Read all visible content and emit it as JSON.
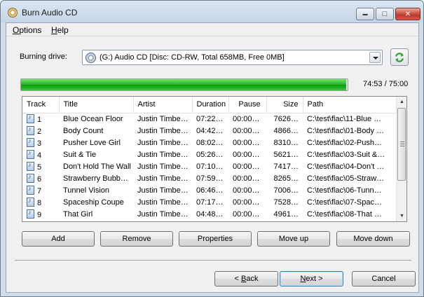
{
  "window": {
    "title": "Burn Audio CD",
    "controls": {
      "minimize": "▬",
      "maximize": "□",
      "close": "✕"
    }
  },
  "menu": [
    {
      "label": "Options",
      "accel": "O",
      "rest": "ptions"
    },
    {
      "label": "Help",
      "accel": "H",
      "rest": "elp"
    }
  ],
  "drive": {
    "label": "Burning drive:",
    "selected": "(G:) Audio CD [Disc: CD-RW, Total 658MB, Free 0MB]"
  },
  "progress": {
    "fraction": 0.9956,
    "text": "74:53 / 75:00",
    "color": "#1fb11f"
  },
  "table": {
    "columns": [
      "Track",
      "Title",
      "Artist",
      "Duration",
      "Pause",
      "Size",
      "Path"
    ],
    "rows": [
      {
        "track": "1",
        "title": "Blue Ocean Floor",
        "artist": "Justin Timbe…",
        "duration": "07:22…",
        "pause": "00:00…",
        "size": "7626…",
        "path": "C:\\test\\flac\\11-Blue …"
      },
      {
        "track": "2",
        "title": "Body Count",
        "artist": "Justin Timbe…",
        "duration": "04:42…",
        "pause": "00:00…",
        "size": "4866…",
        "path": "C:\\test\\flac\\01-Body …"
      },
      {
        "track": "3",
        "title": "Pusher Love Girl",
        "artist": "Justin Timbe…",
        "duration": "08:02…",
        "pause": "00:00…",
        "size": "8310…",
        "path": "C:\\test\\flac\\02-Push…"
      },
      {
        "track": "4",
        "title": "Suit & Tie",
        "artist": "Justin Timbe…",
        "duration": "05:26…",
        "pause": "00:00…",
        "size": "5621…",
        "path": "C:\\test\\flac\\03-Suit &…"
      },
      {
        "track": "5",
        "title": "Don't Hold The Wall",
        "artist": "Justin Timbe…",
        "duration": "07:10…",
        "pause": "00:00…",
        "size": "7417…",
        "path": "C:\\test\\flac\\04-Don't …"
      },
      {
        "track": "6",
        "title": "Strawberry Bubb…",
        "artist": "Justin Timbe…",
        "duration": "07:59…",
        "pause": "00:00…",
        "size": "8265…",
        "path": "C:\\test\\flac\\05-Straw…"
      },
      {
        "track": "7",
        "title": "Tunnel Vision",
        "artist": "Justin Timbe…",
        "duration": "06:46…",
        "pause": "00:00…",
        "size": "7006…",
        "path": "C:\\test\\flac\\06-Tunn…"
      },
      {
        "track": "8",
        "title": "Spaceship Coupe",
        "artist": "Justin Timbe…",
        "duration": "07:17…",
        "pause": "00:00…",
        "size": "7528…",
        "path": "C:\\test\\flac\\07-Spac…"
      },
      {
        "track": "9",
        "title": "That Girl",
        "artist": "Justin Timbe…",
        "duration": "04:48…",
        "pause": "00:00…",
        "size": "4961…",
        "path": "C:\\test\\flac\\08-That …"
      }
    ]
  },
  "actions": {
    "add": "Add",
    "remove": "Remove",
    "properties": "Properties",
    "move_up": "Move up",
    "move_down": "Move down"
  },
  "nav": {
    "back": {
      "label": "< Back",
      "pre": "< ",
      "accel": "B",
      "rest": "ack"
    },
    "next": {
      "label": "Next >",
      "accel": "N",
      "rest": "ext >"
    },
    "cancel": "Cancel"
  }
}
